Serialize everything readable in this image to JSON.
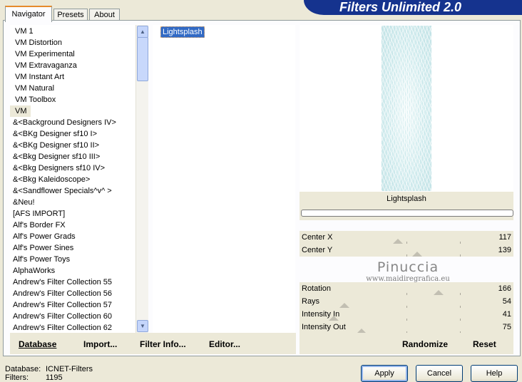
{
  "header": {
    "title": "Filters Unlimited 2.0"
  },
  "tabs": [
    {
      "label": "Navigator",
      "active": true
    },
    {
      "label": "Presets",
      "active": false
    },
    {
      "label": "About",
      "active": false
    }
  ],
  "categories": [
    "VM 1",
    "VM Distortion",
    "VM Experimental",
    "VM Extravaganza",
    "VM Instant Art",
    "VM Natural",
    "VM Toolbox",
    "VM",
    "&<Background Designers IV>",
    "&<BKg Designer sf10 I>",
    "&<BKg Designer sf10 II>",
    "&<Bkg Designer sf10 III>",
    "&<Bkg Designers sf10 IV>",
    "&<Bkg Kaleidoscope>",
    "&<Sandflower Specials^v^ >",
    "&Neu!",
    "[AFS IMPORT]",
    "Alf's Border FX",
    "Alf's Power Grads",
    "Alf's Power Sines",
    "Alf's Power Toys",
    "AlphaWorks",
    "Andrew's Filter Collection 55",
    "Andrew's Filter Collection 56",
    "Andrew's Filter Collection 57",
    "Andrew's Filter Collection 60",
    "Andrew's Filter Collection 62"
  ],
  "selected_category": "VM",
  "filters": [
    "Lightsplash"
  ],
  "preview": {
    "filter_name": "Lightsplash"
  },
  "parameters": [
    {
      "label": "Center X",
      "value": "117",
      "level": 0.46
    },
    {
      "label": "Center Y",
      "value": "139",
      "level": 0.55
    },
    {
      "label": "",
      "value": ""
    },
    {
      "label": "",
      "value": ""
    },
    {
      "label": "Rotation",
      "value": "166",
      "level": 0.65
    },
    {
      "label": "Rays",
      "value": "54",
      "level": 0.21
    },
    {
      "label": "Intensity In",
      "value": "41",
      "level": 0.16
    },
    {
      "label": "Intensity Out",
      "value": "75",
      "level": 0.29
    }
  ],
  "watermark": {
    "line1": "Pinuccia",
    "line2": "www.maidiregrafica.eu"
  },
  "left_actions": {
    "database": "Database",
    "import": "Import...",
    "filter_info": "Filter Info...",
    "editor": "Editor..."
  },
  "right_actions": {
    "randomize": "Randomize",
    "reset": "Reset"
  },
  "status": {
    "database_label": "Database:",
    "database_value": "ICNET-Filters",
    "filters_label": "Filters:",
    "filters_value": "1195"
  },
  "buttons": {
    "apply": "Apply",
    "cancel": "Cancel",
    "help": "Help"
  },
  "colors": {
    "banner": "#15338e",
    "selection": "#316ac5",
    "dialog": "#ece9d8"
  }
}
